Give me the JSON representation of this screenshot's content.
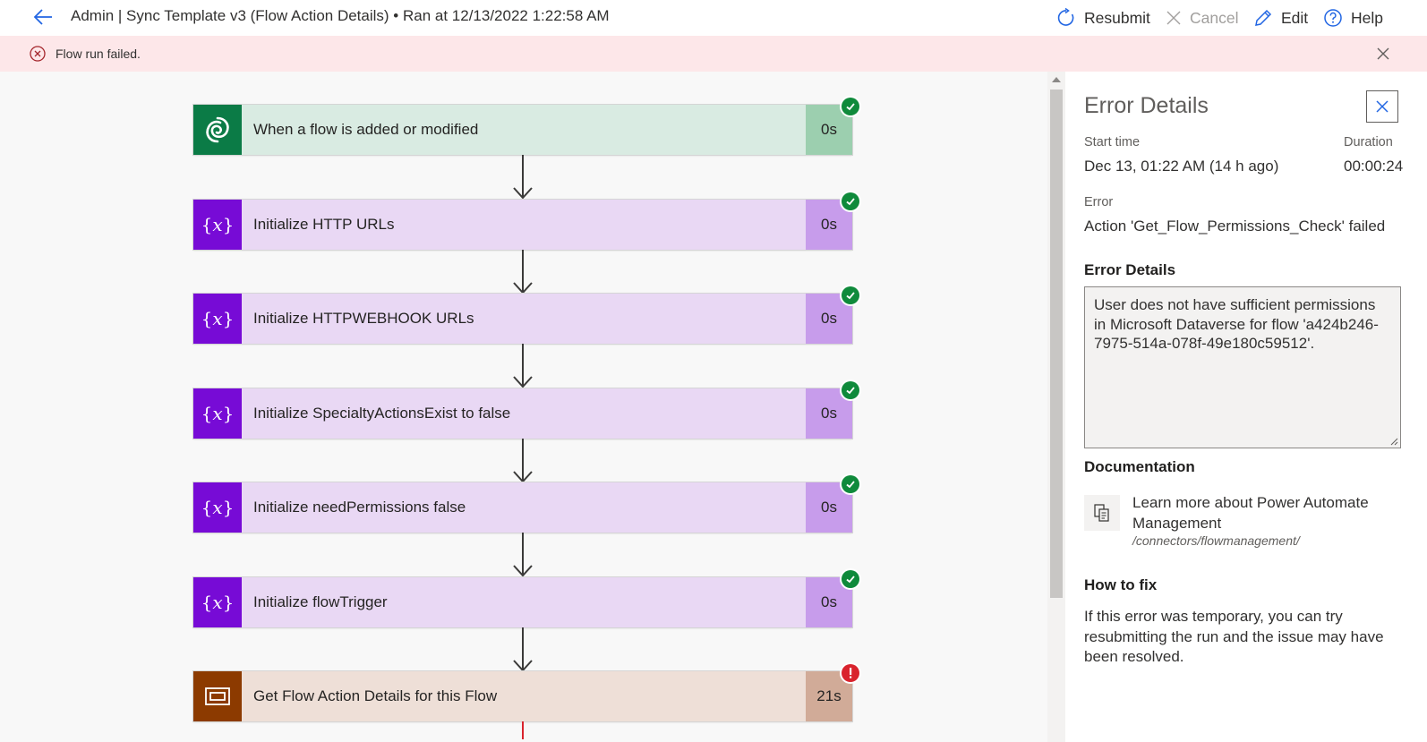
{
  "header": {
    "title": "Admin | Sync Template v3 (Flow Action Details) • Ran at 12/13/2022 1:22:58 AM",
    "commands": {
      "resubmit": "Resubmit",
      "cancel": "Cancel",
      "edit": "Edit",
      "help": "Help"
    }
  },
  "banner": {
    "message": "Flow run failed."
  },
  "steps": [
    {
      "label": "When a flow is added or modified",
      "duration": "0s",
      "status": "succeeded",
      "icon": "dataverse-icon"
    },
    {
      "label": "Initialize HTTP URLs",
      "duration": "0s",
      "status": "succeeded",
      "icon": "variable-icon"
    },
    {
      "label": "Initialize HTTPWEBHOOK URLs",
      "duration": "0s",
      "status": "succeeded",
      "icon": "variable-icon"
    },
    {
      "label": "Initialize SpecialtyActionsExist to false",
      "duration": "0s",
      "status": "succeeded",
      "icon": "variable-icon"
    },
    {
      "label": "Initialize needPermissions false",
      "duration": "0s",
      "status": "succeeded",
      "icon": "variable-icon"
    },
    {
      "label": "Initialize flowTrigger",
      "duration": "0s",
      "status": "succeeded",
      "icon": "variable-icon"
    },
    {
      "label": "Get Flow Action Details for this Flow",
      "duration": "21s",
      "status": "failed",
      "icon": "flow-management-icon"
    }
  ],
  "colors": {
    "trigger_icon_bg": "#0b7b46",
    "trigger_body": "#d9ebe2",
    "trigger_dur": "#9ccfaf",
    "variable_icon_bg": "#770bd6",
    "variable_body": "#e9d8f4",
    "variable_dur": "#c79ceb",
    "mgmt_icon_bg": "#8c3a00",
    "mgmt_body": "#eedfd7",
    "mgmt_dur": "#d1ab98",
    "success": "#0f8a3b",
    "error": "#d9232d"
  },
  "panel": {
    "title": "Error Details",
    "start_time_label": "Start time",
    "start_time_value": "Dec 13, 01:22 AM (14 h ago)",
    "duration_label": "Duration",
    "duration_value": "00:00:24",
    "error_label": "Error",
    "error_value": "Action 'Get_Flow_Permissions_Check' failed",
    "error_details_heading": "Error Details",
    "error_details_text": "User does not have sufficient permissions in Microsoft Dataverse for flow 'a424b246-7975-514a-078f-49e180c59512'.",
    "documentation_heading": "Documentation",
    "doc_link_text": "Learn more about Power Automate Management",
    "doc_link_url": "/connectors/flowmanagement/",
    "how_to_fix_heading": "How to fix",
    "how_to_fix_text": "If this error was temporary, you can try resubmitting the run and the issue may have been resolved."
  }
}
